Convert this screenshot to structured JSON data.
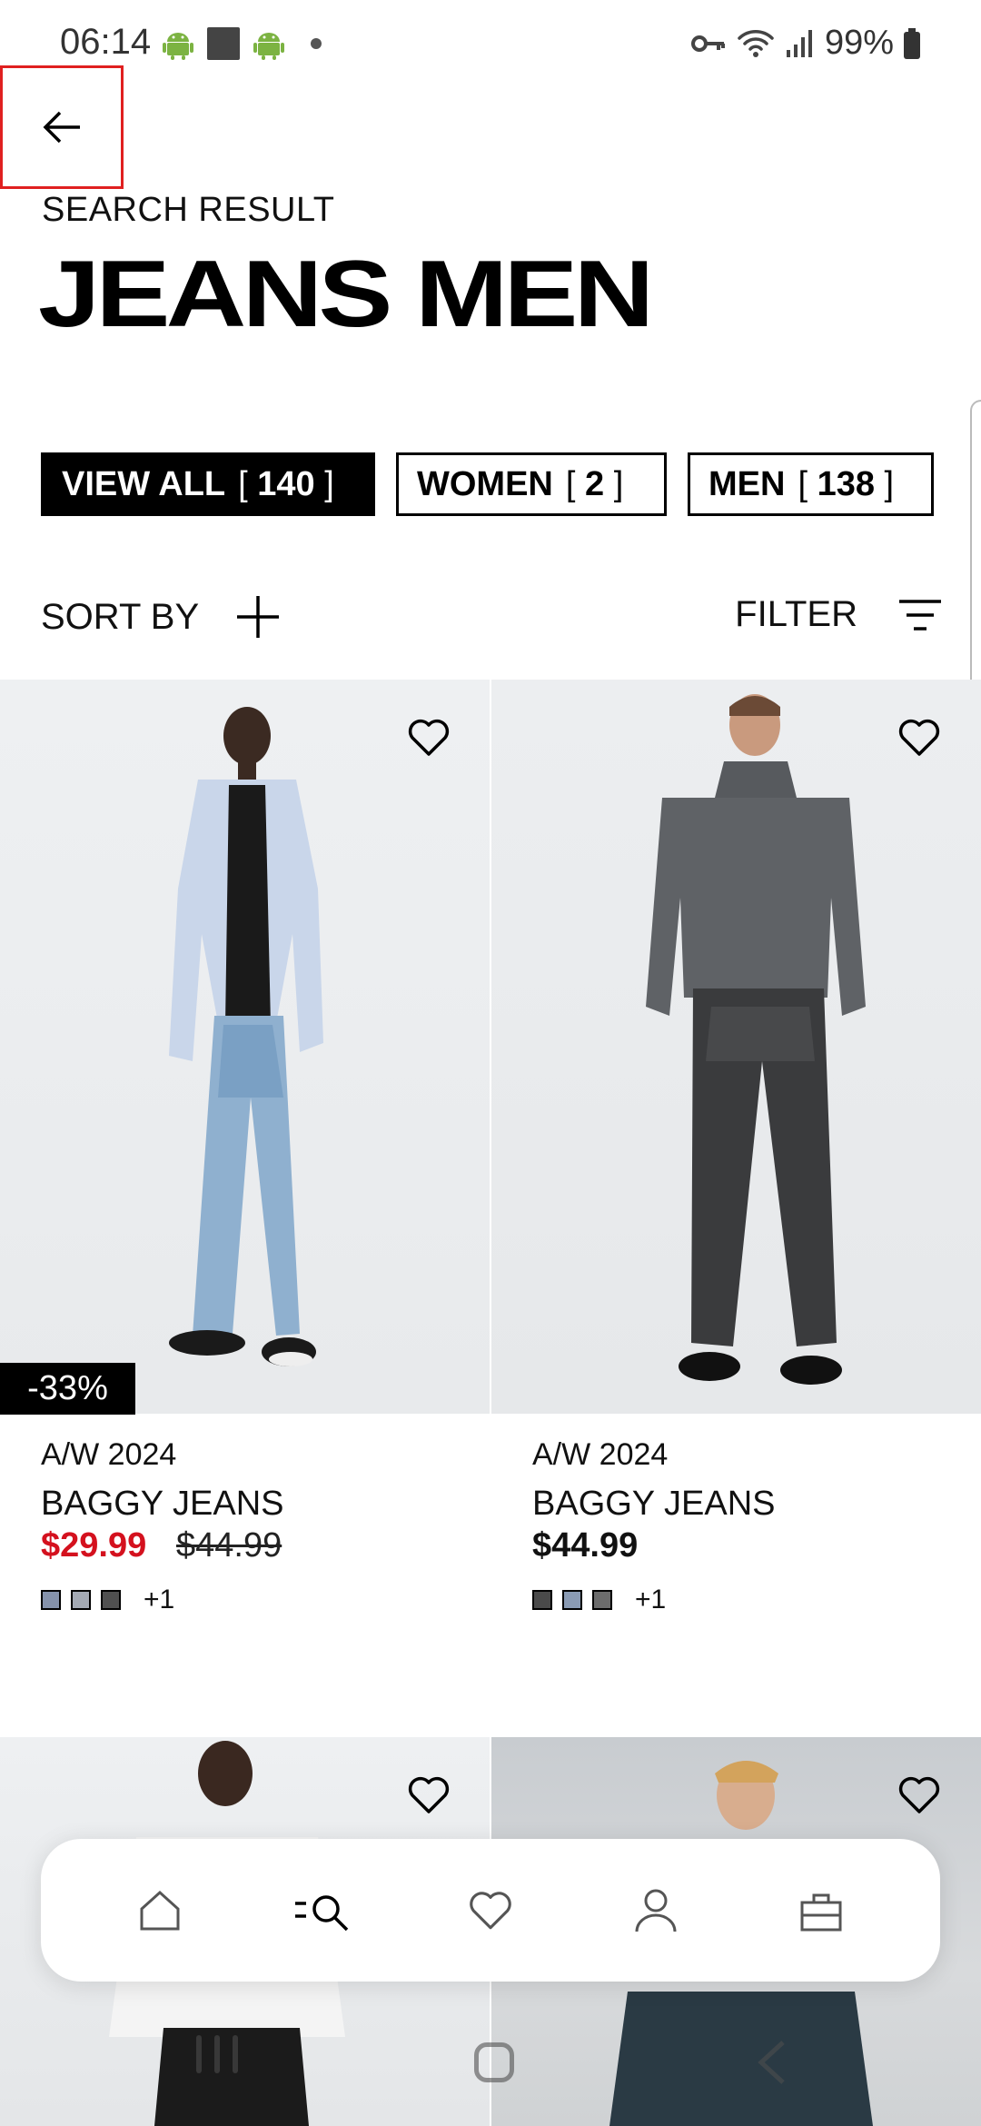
{
  "status_bar": {
    "time": "06:14",
    "battery": "99%"
  },
  "header": {
    "eyebrow": "SEARCH RESULT",
    "title": "JEANS MEN"
  },
  "chips": [
    {
      "label": "VIEW ALL",
      "count": "140",
      "active": true
    },
    {
      "label": "WOMEN",
      "count": "2",
      "active": false
    },
    {
      "label": "MEN",
      "count": "138",
      "active": false
    }
  ],
  "controls": {
    "sort_label": "SORT BY",
    "filter_label": "FILTER"
  },
  "products": [
    {
      "season": "A/W 2024",
      "name": "BAGGY JEANS",
      "price": "$29.99",
      "old_price": "$44.99",
      "discount": "-33%",
      "swatches": [
        "#8592ab",
        "#a4aab4",
        "#505050"
      ],
      "more": "+1"
    },
    {
      "season": "A/W 2024",
      "name": "BAGGY JEANS",
      "price": "$44.99",
      "swatches": [
        "#4a4a4a",
        "#8a9bb4",
        "#6c6c6c"
      ],
      "more": "+1"
    }
  ],
  "colors": {
    "sale_red": "#d4111e",
    "accent": "#000000"
  },
  "bottom_nav": [
    "home-icon",
    "search-icon",
    "heart-icon",
    "user-icon",
    "bag-icon"
  ]
}
